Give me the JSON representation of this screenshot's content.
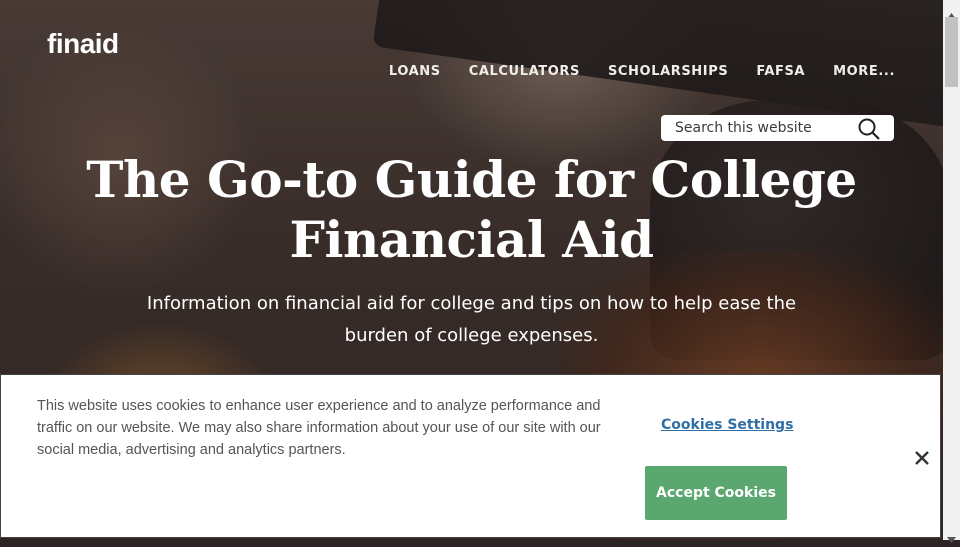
{
  "header": {
    "logo": "finaid",
    "nav": [
      {
        "label": "LOANS"
      },
      {
        "label": "CALCULATORS"
      },
      {
        "label": "SCHOLARSHIPS"
      },
      {
        "label": "FAFSA"
      },
      {
        "label": "MORE..."
      }
    ],
    "search": {
      "placeholder": "Search this website",
      "icon": "search-icon"
    }
  },
  "hero": {
    "title": "The Go-to Guide for College Financial Aid",
    "subtitle": "Information on financial aid for college and tips on how to help ease the burden of college expenses."
  },
  "cookie_banner": {
    "text": "This website uses cookies to enhance user experience and to analyze performance and traffic on our website. We may also share information about your use of our site with our social media, advertising and analytics partners.",
    "settings_label": "Cookies Settings",
    "accept_label": "Accept Cookies",
    "close_icon": "close-icon"
  },
  "colors": {
    "accept_button": "#5aa86f",
    "settings_link": "#2f6fa5"
  }
}
